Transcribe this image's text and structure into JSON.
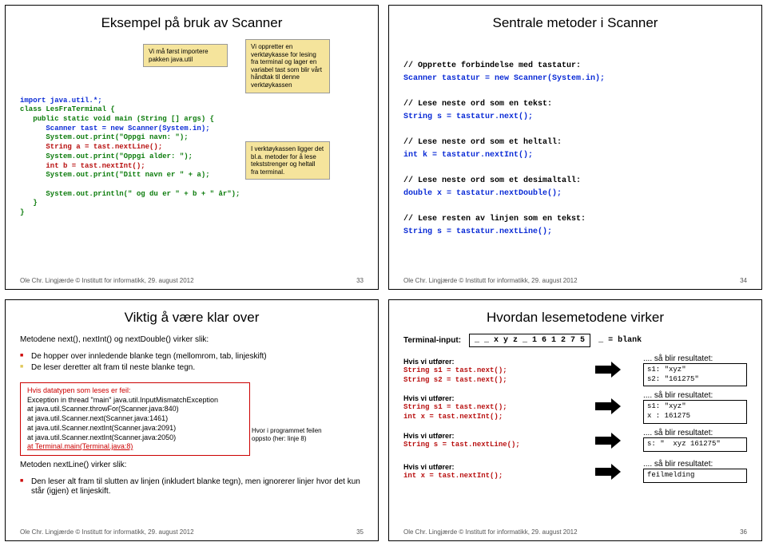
{
  "footer": {
    "credit": "Ole Chr. Lingjærde © Institutt for informatikk, 29. august 2012"
  },
  "slide33": {
    "title": "Eksempel på bruk av Scanner",
    "pageno": "33",
    "callout1": "Vi må først importere pakken java.util",
    "callout2": "Vi oppretter en verktøykasse for lesing fra terminal og lager en variabel tast som blir vårt håndtak til denne verktøykassen",
    "callout3": "I verktøykassen ligger det bl.a. metoder for å lese tekststrenger og heltall fra terminal.",
    "c1": "import java.util.*;",
    "c2": "class LesFraTerminal {",
    "c3": "   public static void main (String [] args) {",
    "c4": "      Scanner tast = new Scanner(System.in);",
    "c5a": "      System.out.print(\"Oppgi navn: \");",
    "c5b": "      String a = tast.nextLine();",
    "c6a": "      System.out.print(\"Oppgi alder: \");",
    "c6b": "      int b = tast.nextInt();",
    "c7": "      System.out.print(\"Ditt navn er \" + a);",
    "c8": "      System.out.println(\" og du er \" + b + \" år\");",
    "c9": "   }",
    "c10": "}"
  },
  "slide34": {
    "title": "Sentrale metoder i Scanner",
    "pageno": "34",
    "h1": "// Opprette forbindelse med tastatur:",
    "l1": "Scanner tastatur = new Scanner(System.in);",
    "h2": "// Lese neste ord som en tekst:",
    "l2": "String s = tastatur.next();",
    "h3": "// Lese neste ord som et heltall:",
    "l3": "int k = tastatur.nextInt();",
    "h4": "// Lese neste ord som et desimaltall:",
    "l4": "double x = tastatur.nextDouble();",
    "h5": "// Lese resten av linjen som en tekst:",
    "l5": "String s = tastatur.nextLine();"
  },
  "slide35": {
    "title": "Viktig å være klar over",
    "pageno": "35",
    "p1": "Metodene next(), nextInt() og nextDouble() virker slik:",
    "b1": "De hopper over innledende blanke tegn (mellomrom, tab, linjeskift)",
    "b2": "De leser deretter alt fram til neste blanke tegn.",
    "errTitle": "Hvis datatypen som leses er feil:",
    "err1": "Exception in thread \"main\" java.util.InputMismatchException",
    "err2": "       at java.util.Scanner.throwFor(Scanner.java:840)",
    "err3": "       at java.util.Scanner.next(Scanner.java:1461)",
    "err4": "       at java.util.Scanner.nextInt(Scanner.java:2091)",
    "err5": "       at java.util.Scanner.nextInt(Scanner.java:2050)",
    "err6": "       at Terminal.main(Terminal.java:8)",
    "anno": "Hvor i programmet feilen oppsto (her: linje 8)",
    "p2": "Metoden nextLine() virker slik:",
    "b3": "Den leser alt fram til slutten av linjen (inkludert blanke tegn), men ignorerer linjer hvor det kun står (igjen) et linjeskift."
  },
  "slide36": {
    "title": "Hvordan lesemetodene virker",
    "pageno": "36",
    "tlabel": "Terminal-input:",
    "tinput": "_ _ x y z _ 1 6 1 2 7 5",
    "blank": "_ = blank",
    "hvis1": "Hvis vi utfører:",
    "c1a": "String s1 = tast.next();",
    "c1b": "String s2 = tast.next();",
    "r1h": ".... så blir resultatet:",
    "r1a": "s1: \"xyz\"",
    "r1b": "s2: \"161275\"",
    "c2a": "String s1 = tast.next();",
    "c2b": "int x = tast.nextInt();",
    "r2a": "s1: \"xyz\"",
    "r2b": "x : 161275",
    "c3a": "String s = tast.nextLine();",
    "r3a": "s: \"  xyz 161275\"",
    "c4a": "int x = tast.nextInt();",
    "r4a": "feilmelding"
  }
}
